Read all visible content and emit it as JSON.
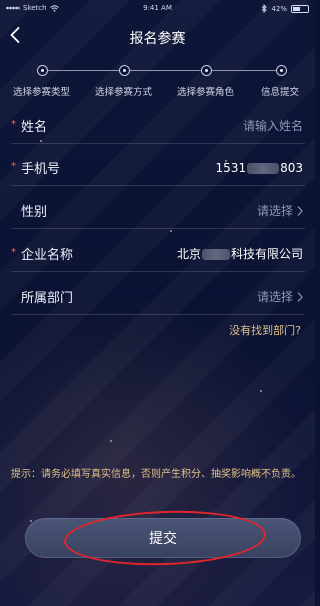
{
  "status_bar": {
    "carrier": "Sketch",
    "time": "9:41 AM",
    "battery": "42%"
  },
  "header": {
    "back_icon": "chevron-left-icon",
    "title": "报名参赛"
  },
  "steps": [
    {
      "label": "选择参赛类型"
    },
    {
      "label": "选择参赛方式"
    },
    {
      "label": "选择参赛角色"
    },
    {
      "label": "信息提交"
    }
  ],
  "form": {
    "name": {
      "label": "姓名",
      "placeholder": "请输入姓名",
      "required": true
    },
    "phone": {
      "label": "手机号",
      "prefix": "1531",
      "suffix": "803",
      "required": true
    },
    "gender": {
      "label": "性别",
      "placeholder": "请选择",
      "required": false
    },
    "company": {
      "label": "企业名称",
      "prefix": "北京",
      "suffix": "科技有限公司",
      "required": true
    },
    "department": {
      "label": "所属部门",
      "placeholder": "请选择",
      "required": false
    }
  },
  "not_found_link": "没有找到部门?",
  "tip": "提示：请务必填写真实信息，否则产生积分、抽奖影响概不负责。",
  "submit_label": "提交",
  "colors": {
    "accent_gold": "#e1c089",
    "required_star": "#ff6a55",
    "annotation_red": "#e0262b"
  }
}
